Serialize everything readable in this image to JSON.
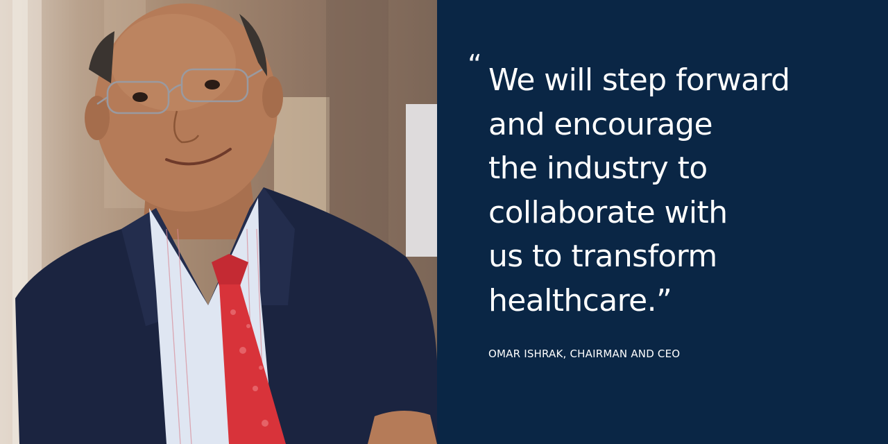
{
  "photo": {
    "subject": "portrait-of-smiling-man-in-suit-and-red-tie"
  },
  "quote": {
    "open_mark": "“",
    "lines": [
      "We will step forward",
      "and encourage",
      "the industry to",
      "collaborate with",
      "us to transform",
      "healthcare.”"
    ]
  },
  "attribution": "OMAR ISHRAK, CHAIRMAN AND CEO",
  "colors": {
    "panel_background": "#0a2645",
    "text": "#ffffff",
    "tie": "#d8333a",
    "suit": "#1b2440"
  }
}
